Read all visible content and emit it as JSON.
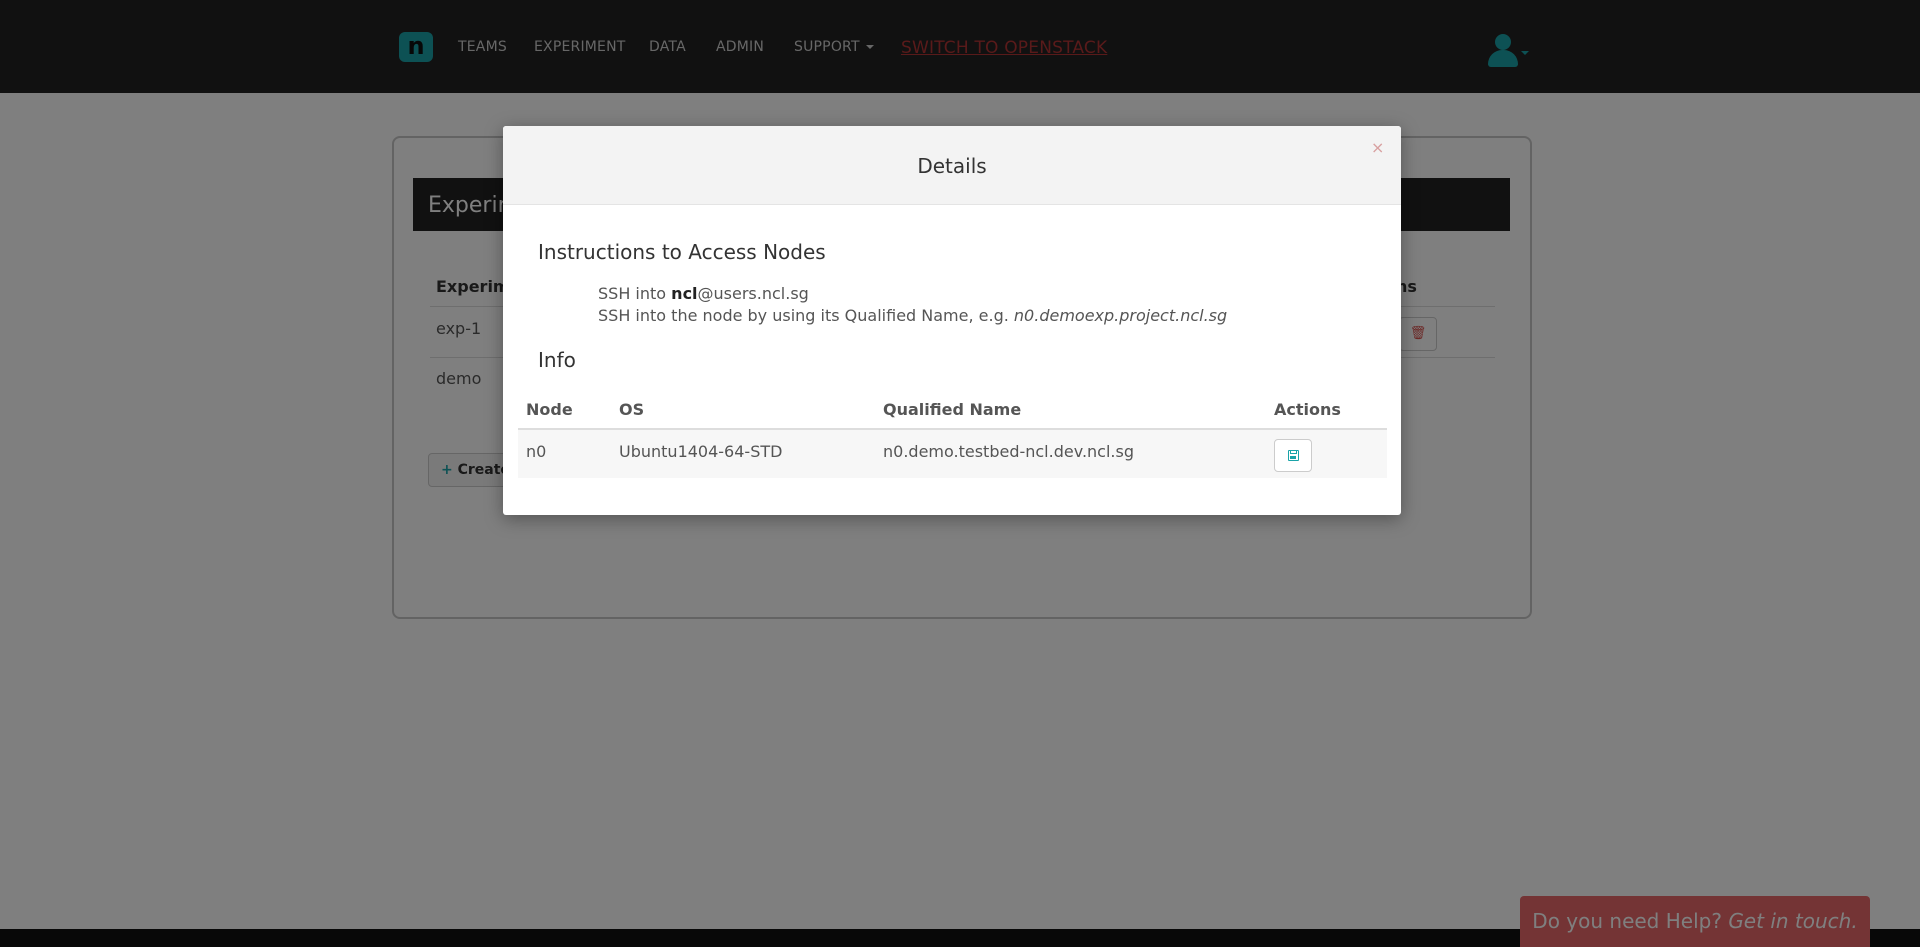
{
  "navbar": {
    "brand_letter": "n",
    "items": [
      {
        "label": "TEAMS"
      },
      {
        "label": "EXPERIMENT"
      },
      {
        "label": "DATA"
      },
      {
        "label": "ADMIN"
      },
      {
        "label": "SUPPORT"
      }
    ],
    "openstack_link": "SWITCH TO OPENSTACK",
    "user_icon": "user-icon"
  },
  "background_page": {
    "panel_title": "Experim",
    "columns": {
      "experiment": "Experim",
      "actions": "ns"
    },
    "rows": [
      {
        "name": "exp-1"
      },
      {
        "name": "demo"
      }
    ],
    "create_button": "Create",
    "trash_icon": "trash-icon"
  },
  "modal": {
    "title": "Details",
    "close_symbol": "×",
    "instructions_heading": "Instructions to Access Nodes",
    "ssh_line1_prefix": "SSH into ",
    "ssh_line1_user": "ncl",
    "ssh_line1_host": "@users.ncl.sg",
    "ssh_line2_prefix": "SSH into the node by using its Qualified Name, e.g. ",
    "ssh_line2_example": "n0.demoexp.project.ncl.sg",
    "info_heading": "Info",
    "table": {
      "headers": {
        "node": "Node",
        "os": "OS",
        "qualified_name": "Qualified Name",
        "actions": "Actions"
      },
      "rows": [
        {
          "node": "n0",
          "os": "Ubuntu1404-64-STD",
          "qualified_name": "n0.demo.testbed-ncl.dev.ncl.sg",
          "action_icon": "save-icon"
        }
      ]
    }
  },
  "help": {
    "text": "Do you need Help? ",
    "emphasis": "Get in touch."
  },
  "colors": {
    "navbar_bg": "#222222",
    "accent": "#1aa3a8",
    "openstack_link": "#b23434",
    "help_bg": "#e8696a"
  }
}
